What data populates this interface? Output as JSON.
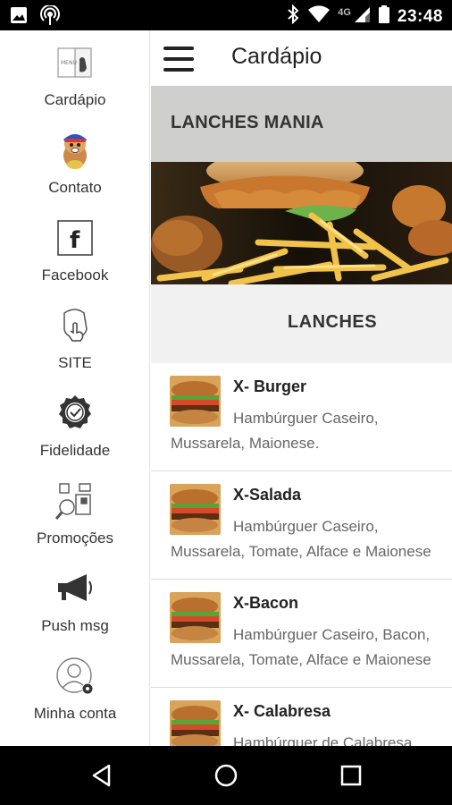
{
  "status_bar": {
    "time": "23:48",
    "network": "4G",
    "icons": [
      "image-icon",
      "broadcast-icon",
      "bluetooth-icon",
      "wifi-icon",
      "signal-icon",
      "battery-icon"
    ]
  },
  "drawer": {
    "items": [
      {
        "label": "Cardápio",
        "icon": "menu-card-icon"
      },
      {
        "label": "Contato",
        "icon": "mascot-contact-icon"
      },
      {
        "label": "Facebook",
        "icon": "facebook-icon"
      },
      {
        "label": "SITE",
        "icon": "site-touch-icon"
      },
      {
        "label": "Fidelidade",
        "icon": "loyalty-badge-icon"
      },
      {
        "label": "Promoções",
        "icon": "promotions-search-icon"
      },
      {
        "label": "Push msg",
        "icon": "megaphone-icon"
      },
      {
        "label": "Minha conta",
        "icon": "account-settings-icon"
      }
    ]
  },
  "app_bar": {
    "title": "Cardápio",
    "menu_icon": "hamburger-menu-icon"
  },
  "banner": {
    "title": "LANCHES MANIA"
  },
  "section": {
    "title": "LANCHES"
  },
  "menu_items": [
    {
      "name": "X- Burger",
      "description": "Hambúrguer Caseiro, Mussarela, Maionese."
    },
    {
      "name": "X-Salada",
      "description": "Hambúrguer Caseiro, Mussarela, Tomate, Alface e Maionese"
    },
    {
      "name": "X-Bacon",
      "description": "Hambúrguer Caseiro, Bacon, Mussarela, Tomate, Alface e Maionese"
    },
    {
      "name": "X- Calabresa",
      "description": "Hambúrguer de Calabresa, Mussarela"
    }
  ],
  "nav_bar": {
    "buttons": [
      "back-icon",
      "home-icon",
      "recents-icon"
    ]
  },
  "colors": {
    "status_bar": "#000000",
    "drawer_bg": "#ffffff",
    "section_bg": "#f1f1f1",
    "title_bar_overlay": "#dedede"
  }
}
